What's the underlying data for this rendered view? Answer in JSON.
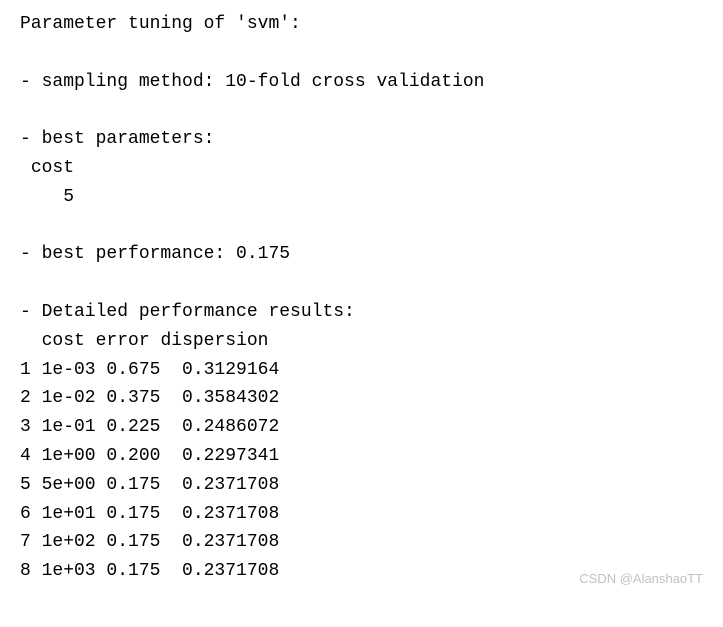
{
  "header": {
    "title": "Parameter tuning of 'svm':"
  },
  "sampling": {
    "label": "- sampling method: ",
    "value": "10-fold cross validation"
  },
  "best_params": {
    "label": "- best parameters:",
    "param_name": "cost",
    "param_value": "5"
  },
  "best_perf": {
    "label": "- best performance: ",
    "value": "0.175"
  },
  "detailed": {
    "label": "- Detailed performance results:",
    "headers": [
      "cost",
      "error",
      "dispersion"
    ],
    "rows": [
      {
        "idx": "1",
        "cost": "1e-03",
        "error": "0.675",
        "dispersion": "0.3129164"
      },
      {
        "idx": "2",
        "cost": "1e-02",
        "error": "0.375",
        "dispersion": "0.3584302"
      },
      {
        "idx": "3",
        "cost": "1e-01",
        "error": "0.225",
        "dispersion": "0.2486072"
      },
      {
        "idx": "4",
        "cost": "1e+00",
        "error": "0.200",
        "dispersion": "0.2297341"
      },
      {
        "idx": "5",
        "cost": "5e+00",
        "error": "0.175",
        "dispersion": "0.2371708"
      },
      {
        "idx": "6",
        "cost": "1e+01",
        "error": "0.175",
        "dispersion": "0.2371708"
      },
      {
        "idx": "7",
        "cost": "1e+02",
        "error": "0.175",
        "dispersion": "0.2371708"
      },
      {
        "idx": "8",
        "cost": "1e+03",
        "error": "0.175",
        "dispersion": "0.2371708"
      }
    ]
  },
  "watermark": "CSDN @AlanshaoTT"
}
